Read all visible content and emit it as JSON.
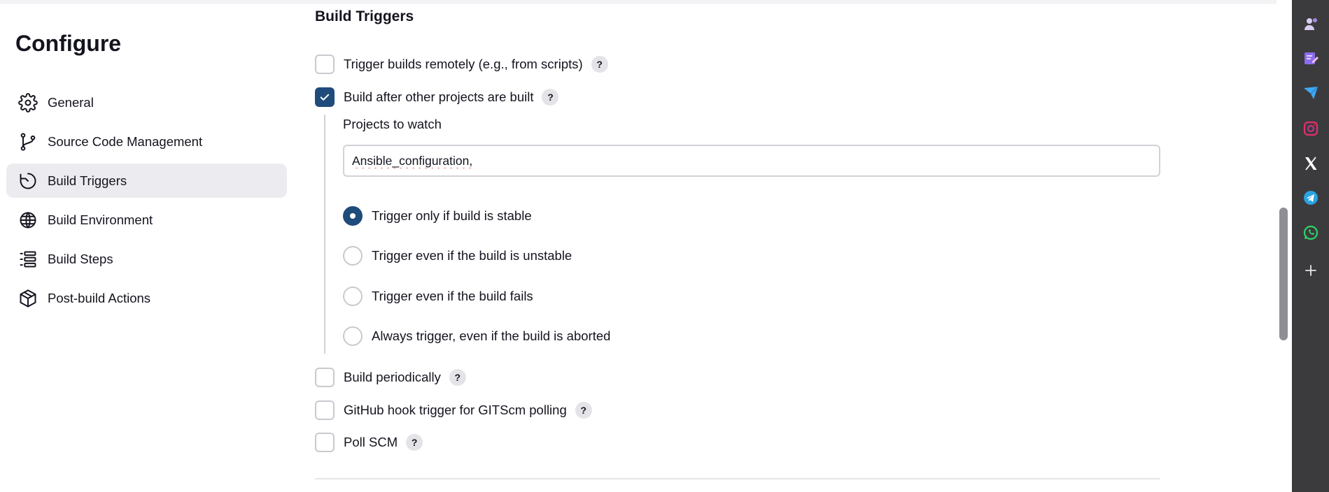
{
  "page_title": "Configure",
  "nav": {
    "items": [
      {
        "label": "General",
        "icon": "gear-icon",
        "active": false
      },
      {
        "label": "Source Code Management",
        "icon": "branch-icon",
        "active": false
      },
      {
        "label": "Build Triggers",
        "icon": "clock-icon",
        "active": true
      },
      {
        "label": "Build Environment",
        "icon": "globe-icon",
        "active": false
      },
      {
        "label": "Build Steps",
        "icon": "list-icon",
        "active": false
      },
      {
        "label": "Post-build Actions",
        "icon": "package-icon",
        "active": false
      }
    ]
  },
  "section": {
    "title": "Build Triggers",
    "triggers": {
      "remote": {
        "label": "Trigger builds remotely (e.g., from scripts)",
        "checked": false,
        "help": "?"
      },
      "after_other": {
        "label": "Build after other projects are built",
        "checked": true,
        "help": "?"
      },
      "periodic": {
        "label": "Build periodically",
        "checked": false,
        "help": "?"
      },
      "github_hook": {
        "label": "GitHub hook trigger for GITScm polling",
        "checked": false,
        "help": "?"
      },
      "poll_scm": {
        "label": "Poll SCM",
        "checked": false,
        "help": "?"
      }
    },
    "projects_to_watch": {
      "label": "Projects to watch",
      "value": "Ansible_configuration,"
    },
    "trigger_options": [
      {
        "label": "Trigger only if build is stable",
        "selected": true
      },
      {
        "label": "Trigger even if the build is unstable",
        "selected": false
      },
      {
        "label": "Trigger even if the build fails",
        "selected": false
      },
      {
        "label": "Always trigger, even if the build is aborted",
        "selected": false
      }
    ]
  },
  "browser_sidebar": {
    "icons": [
      "profile-icon",
      "notes-icon",
      "send-icon",
      "instagram-icon",
      "x-icon",
      "telegram-icon",
      "whatsapp-icon",
      "add-icon"
    ]
  },
  "colors": {
    "accent": "#1f4c7a",
    "active_nav_bg": "#ececf0",
    "sidebar_bg": "#3b3b3d"
  }
}
